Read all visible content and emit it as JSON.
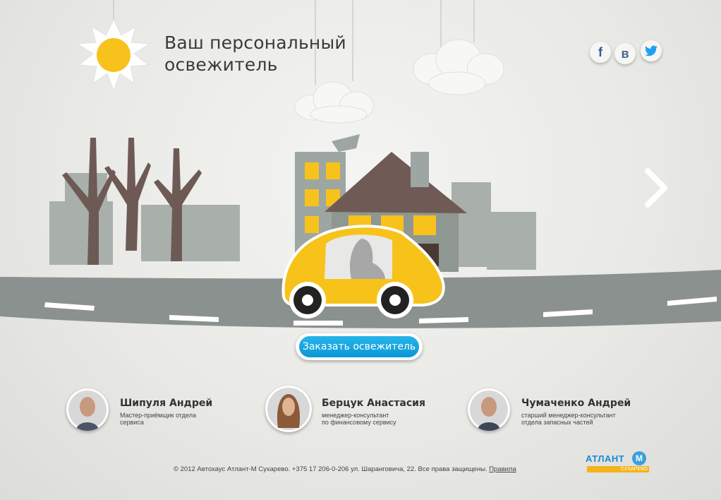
{
  "header": {
    "title_line1": "Ваш персональный",
    "title_line2": "освежитель"
  },
  "social": {
    "facebook": "f",
    "vkontakte": "в",
    "twitter": "twitter-icon"
  },
  "cta": {
    "order_label": "Заказать освежитель"
  },
  "team": [
    {
      "name": "Шипуля Андрей",
      "role_line1": "Мастер-приёмщик отдела",
      "role_line2": "сервиса"
    },
    {
      "name": "Берцук Анастасия",
      "role_line1": "менеджер-консультант",
      "role_line2": "по финансовому сервису"
    },
    {
      "name": "Чумаченко Андрей",
      "role_line1": "старший менеджер-консультант",
      "role_line2": "отдела запасных частей"
    }
  ],
  "footer": {
    "copyright": "© 2012 Автохаус Атлант-М Сухарево. +375 17 206-0-206 ул. Шаранговича, 22. Все права защищены.",
    "rules_link": "Правила"
  },
  "logo": {
    "brand": "АТЛАНТ",
    "sub": "СУХАРЕВО",
    "letter": "М"
  },
  "colors": {
    "accent": "#0a98d6",
    "car": "#f7c21a",
    "logo_yellow": "#f3b319"
  }
}
